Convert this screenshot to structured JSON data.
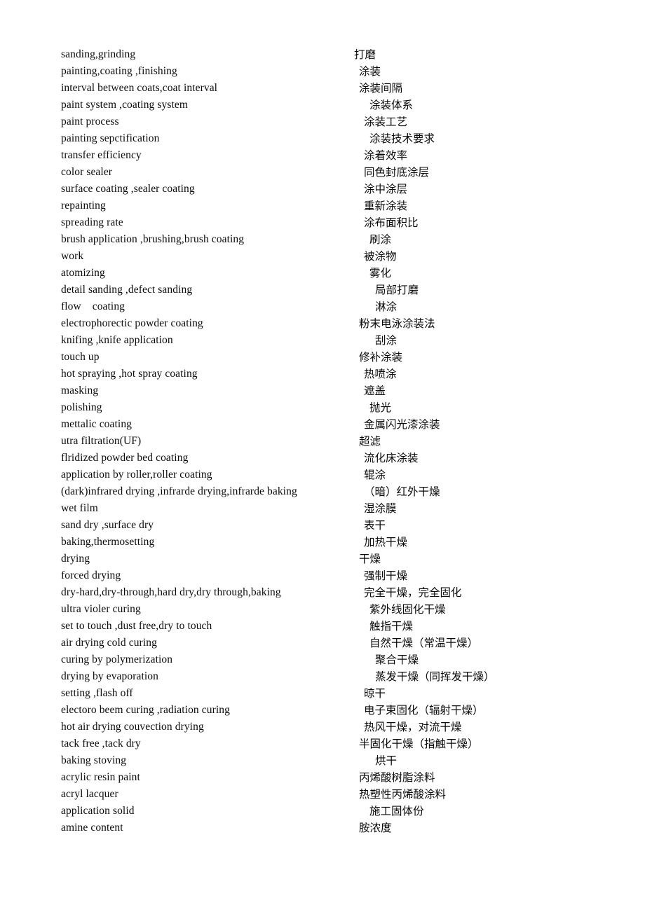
{
  "document": {
    "type": "bilingual-glossary",
    "language_pair": "English-Chinese",
    "column_headers_visible": false
  },
  "entries": [
    {
      "en": "sanding,grinding",
      "zh": "打磨",
      "indent": 0
    },
    {
      "en": "painting,coating ,finishing",
      "zh": "涂装",
      "indent": 1
    },
    {
      "en": "interval between coats,coat interval",
      "zh": "涂装间隔",
      "indent": 1
    },
    {
      "en": "paint system ,coating system",
      "zh": "涂装体系",
      "indent": 3
    },
    {
      "en": "paint process",
      "zh": "涂装工艺",
      "indent": 2
    },
    {
      "en": "painting sepctification",
      "zh": "涂装技术要求",
      "indent": 3
    },
    {
      "en": "transfer efficiency",
      "zh": "涂着效率",
      "indent": 2
    },
    {
      "en": "color sealer",
      "zh": "同色封底涂层",
      "indent": 2
    },
    {
      "en": "surface coating ,sealer coating",
      "zh": "涂中涂层",
      "indent": 2
    },
    {
      "en": "repainting",
      "zh": "重新涂装",
      "indent": 2
    },
    {
      "en": "spreading rate",
      "zh": "涂布面积比",
      "indent": 2
    },
    {
      "en": "brush application ,brushing,brush coating",
      "zh": "刷涂",
      "indent": 3
    },
    {
      "en": "work",
      "zh": "被涂物",
      "indent": 2
    },
    {
      "en": "atomizing",
      "zh": "雾化",
      "indent": 3
    },
    {
      "en": "detail sanding ,defect sanding",
      "zh": "局部打磨",
      "indent": 4
    },
    {
      "en": "flow    coating",
      "zh": "淋涂",
      "indent": 4
    },
    {
      "en": "electrophorectic powder coating",
      "zh": "粉末电泳涂装法",
      "indent": 1
    },
    {
      "en": "knifing ,knife application",
      "zh": "刮涂",
      "indent": 4
    },
    {
      "en": "touch up",
      "zh": "修补涂装",
      "indent": 1
    },
    {
      "en": "hot spraying ,hot spray coating",
      "zh": "热喷涂",
      "indent": 2
    },
    {
      "en": "masking",
      "zh": "遮盖",
      "indent": 2
    },
    {
      "en": "polishing",
      "zh": "抛光",
      "indent": 3
    },
    {
      "en": "mettalic coating",
      "zh": "金属闪光漆涂装",
      "indent": 2
    },
    {
      "en": "utra filtration(UF)",
      "zh": "超滤",
      "indent": 1
    },
    {
      "en": "flridized powder bed coating",
      "zh": "流化床涂装",
      "indent": 2
    },
    {
      "en": "application by roller,roller coating",
      "zh": "辊涂",
      "indent": 2
    },
    {
      "en": "(dark)infrared drying ,infrarde drying,infrarde baking",
      "zh": "（暗）红外干燥",
      "indent": 2
    },
    {
      "en": "wet film",
      "zh": "湿涂膜",
      "indent": 2
    },
    {
      "en": "sand dry ,surface dry",
      "zh": "表干",
      "indent": 2
    },
    {
      "en": "baking,thermosetting",
      "zh": "加热干燥",
      "indent": 2
    },
    {
      "en": "drying",
      "zh": "干燥",
      "indent": 1
    },
    {
      "en": "forced drying",
      "zh": "强制干燥",
      "indent": 2
    },
    {
      "en": "dry-hard,dry-through,hard dry,dry through,baking",
      "zh": "完全干燥，完全固化",
      "indent": 2
    },
    {
      "en": "ultra violer curing",
      "zh": "紫外线固化干燥",
      "indent": 3
    },
    {
      "en": "set to touch ,dust free,dry to touch",
      "zh": "触指干燥",
      "indent": 3
    },
    {
      "en": "air drying cold curing",
      "zh": "自然干燥（常温干燥）",
      "indent": 3
    },
    {
      "en": "curing by polymerization",
      "zh": "聚合干燥",
      "indent": 4
    },
    {
      "en": "drying by evaporation",
      "zh": "蒸发干燥（同挥发干燥）",
      "indent": 4
    },
    {
      "en": "setting ,flash off",
      "zh": "晾干",
      "indent": 2
    },
    {
      "en": "electoro beem curing ,radiation curing",
      "zh": "电子束固化（辐射干燥）",
      "indent": 2
    },
    {
      "en": "hot air drying couvection drying",
      "zh": "热风干燥，对流干燥",
      "indent": 2
    },
    {
      "en": "tack free ,tack dry",
      "zh": "半固化干燥（指触干燥）",
      "indent": 1
    },
    {
      "en": "baking stoving",
      "zh": "烘干",
      "indent": 4
    },
    {
      "en": "acrylic resin paint",
      "zh": "丙烯酸树脂涂料",
      "indent": 1
    },
    {
      "en": "acryl lacquer",
      "zh": "热塑性丙烯酸涂料",
      "indent": 1
    },
    {
      "en": "application solid",
      "zh": "施工固体份",
      "indent": 3
    },
    {
      "en": "amine content",
      "zh": "胺浓度",
      "indent": 1
    }
  ]
}
